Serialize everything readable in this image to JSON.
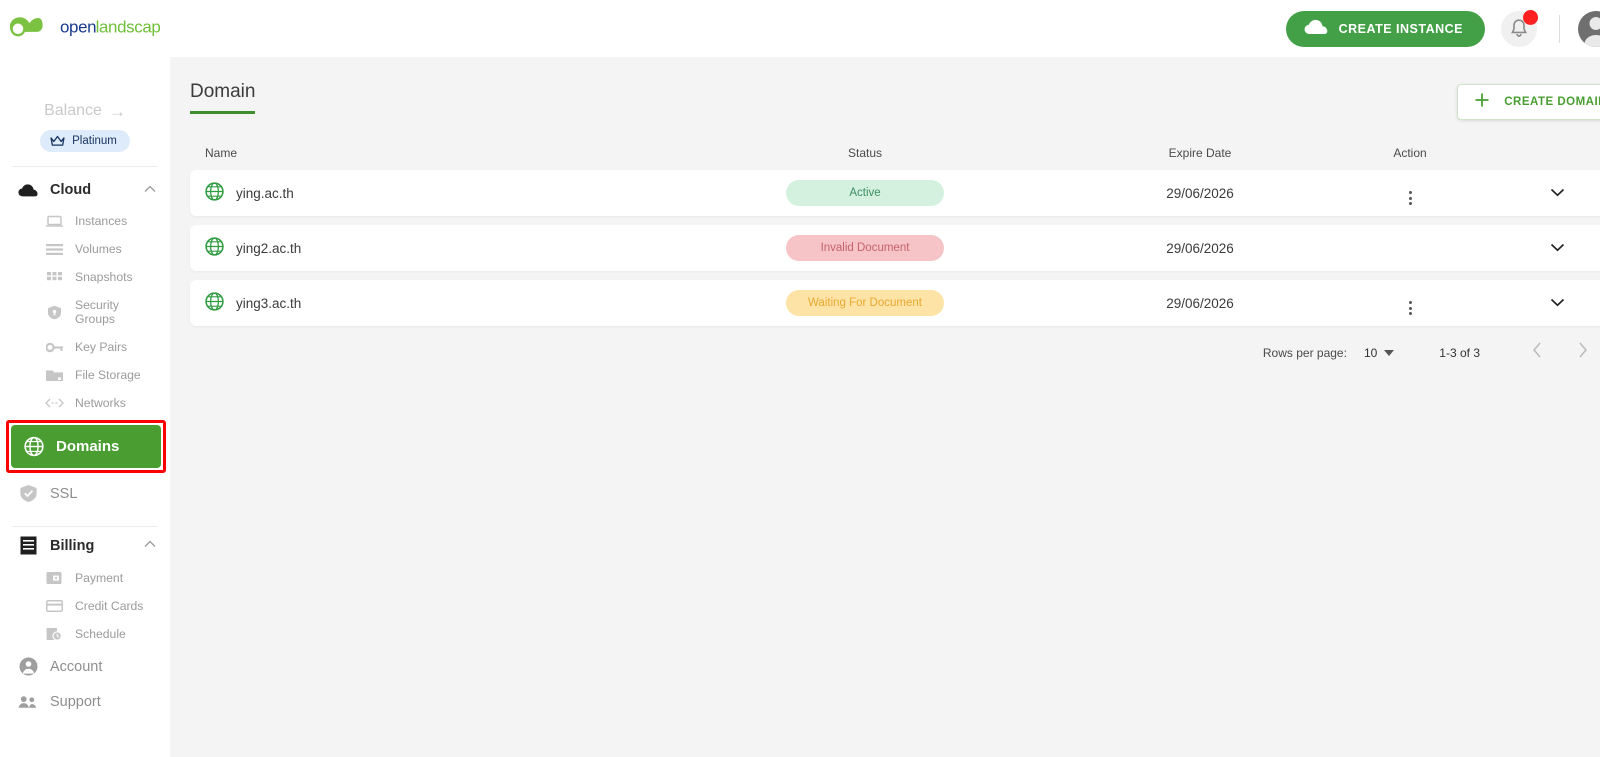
{
  "brand": {
    "logo_text_open": "open",
    "logo_text_landscape": "landscape",
    "accent_green": "#4a9e31",
    "accent_blue": "#1a3a8f",
    "highlight_red": "#ff0000"
  },
  "sidebar": {
    "balance": {
      "label": "Balance",
      "arrow": "→"
    },
    "tier_badge": {
      "label": "Platinum",
      "icon": "crown-icon"
    },
    "groups": [
      {
        "label": "Cloud",
        "icon": "cloud-icon",
        "expanded_icon": "chevron-up-icon",
        "items": [
          {
            "label": "Instances",
            "icon": "laptop-icon"
          },
          {
            "label": "Volumes",
            "icon": "volumes-icon"
          },
          {
            "label": "Snapshots",
            "icon": "snapshots-icon"
          },
          {
            "label": "Security Groups",
            "icon": "shield-icon"
          },
          {
            "label": "Key Pairs",
            "icon": "key-icon"
          },
          {
            "label": "File Storage",
            "icon": "folder-icon"
          },
          {
            "label": "Networks",
            "icon": "code-brackets-icon"
          }
        ]
      }
    ],
    "active_item": {
      "label": "Domains",
      "icon": "globe-icon",
      "highlighted": true
    },
    "ssl_item": {
      "label": "SSL",
      "icon": "shield-check-icon"
    },
    "billing_group": {
      "label": "Billing",
      "icon": "receipt-icon",
      "expanded_icon": "chevron-up-icon",
      "items": [
        {
          "label": "Payment",
          "icon": "wallet-icon"
        },
        {
          "label": "Credit Cards",
          "icon": "credit-card-icon"
        },
        {
          "label": "Schedule",
          "icon": "schedule-icon"
        }
      ]
    },
    "account_item": {
      "label": "Account",
      "icon": "user-circle-icon"
    },
    "support_item": {
      "label": "Support",
      "icon": "people-icon"
    }
  },
  "topbar": {
    "create_instance_label": "CREATE INSTANCE",
    "create_instance_icon": "cloud-icon",
    "bell_icon": "bell-icon",
    "has_notification": true,
    "avatar_icon": "avatar-icon"
  },
  "page": {
    "title": "Domain",
    "create_domain_label": "CREATE DOMAIN",
    "create_domain_icon": "plus-icon"
  },
  "table": {
    "columns": [
      "Name",
      "Status",
      "Expire Date",
      "Action"
    ],
    "rows": [
      {
        "icon": "globe-icon",
        "name": "ying.ac.th",
        "status": "Active",
        "status_kind": "active",
        "expire_date": "29/06/2026",
        "has_kebab": true,
        "expand_icon": "chevron-down-icon"
      },
      {
        "icon": "globe-icon",
        "name": "ying2.ac.th",
        "status": "Invalid Document",
        "status_kind": "invalid",
        "expire_date": "29/06/2026",
        "has_kebab": false,
        "expand_icon": "chevron-down-icon"
      },
      {
        "icon": "globe-icon",
        "name": "ying3.ac.th",
        "status": "Waiting For Document",
        "status_kind": "waiting",
        "expire_date": "29/06/2026",
        "has_kebab": true,
        "expand_icon": "chevron-down-icon"
      }
    ]
  },
  "pagination": {
    "rows_per_page_label": "Rows per page:",
    "rows_per_page_value": "10",
    "range_label": "1-3 of 3",
    "prev_icon": "chevron-left-icon",
    "next_icon": "chevron-right-icon"
  },
  "status_colors": {
    "active_bg": "#d4f1e0",
    "active_fg": "#3f8f63",
    "invalid_bg": "#f6c3c6",
    "invalid_fg": "#c4636c",
    "waiting_bg": "#fde4a6",
    "waiting_fg": "#e8a832"
  }
}
